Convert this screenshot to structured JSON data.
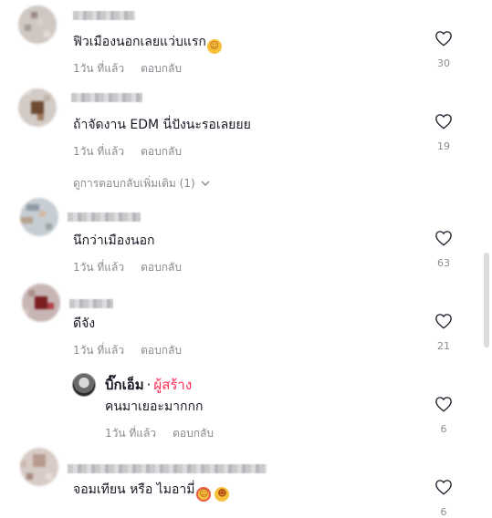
{
  "comments": [
    {
      "text": "ฟิวเมืองนอกเลยแว่บแรก",
      "time": "1วัน ที่แล้ว",
      "reply": "ตอบกลับ",
      "likes": "30",
      "emoji": "smiling-face-with-hearts"
    },
    {
      "text": "ถ้าจัดงาน EDM นี่ปังนะรอเลยยย",
      "time": "1วัน ที่แล้ว",
      "reply": "ตอบกลับ",
      "likes": "19"
    },
    {
      "text": "นึกว่าเมืองนอก",
      "time": "1วัน ที่แล้ว",
      "reply": "ตอบกลับ",
      "likes": "63"
    },
    {
      "text": "ดีจัง",
      "time": "1วัน ที่แล้ว",
      "reply": "ตอบกลับ",
      "likes": "21"
    },
    {
      "text": "จอมเทียน หรือ ไมอามี่",
      "time": "",
      "reply": "",
      "likes": "6",
      "emoji": "smiling-face-with-hearts, grinning-face"
    }
  ],
  "more_replies": "ดูการตอบกลับเพิ่มเติม (1)",
  "creator_reply": {
    "name": "บิ๊กเอ็ม",
    "separator": "·",
    "badge": "ผู้สร้าง",
    "text": "คนมาเยอะมากกก",
    "time": "1วัน ที่แล้ว",
    "reply": "ตอบกลับ",
    "likes": "6"
  },
  "icons": {
    "like": "heart-outline-icon",
    "expand": "chevron-down-icon"
  },
  "colors": {
    "text": "#161823",
    "muted": "#8a8b91",
    "creator_badge": "#fe2c55"
  }
}
